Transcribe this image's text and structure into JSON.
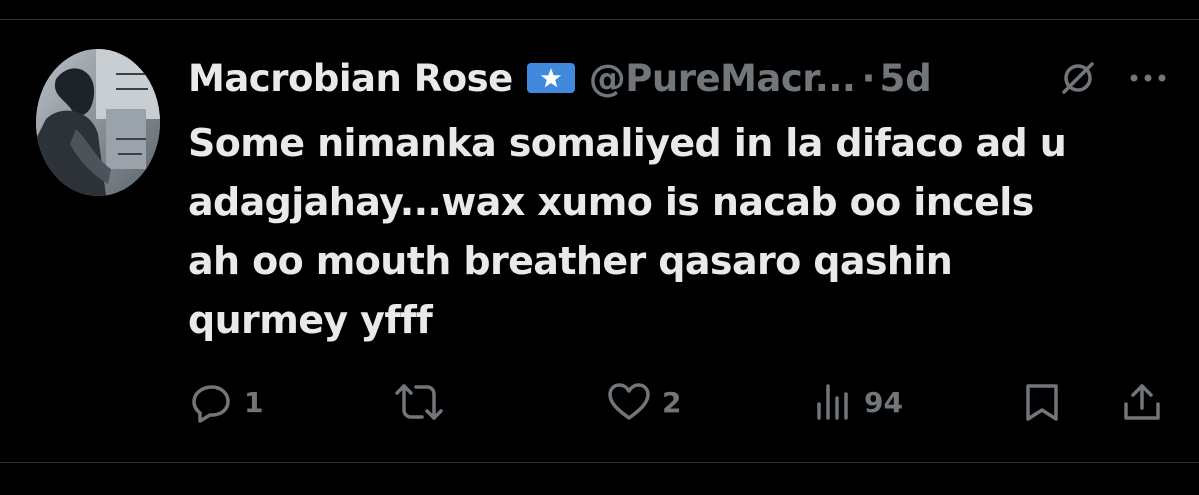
{
  "tweet": {
    "display_name": "Macrobian Rose",
    "flag_icon": "somalia-flag-icon",
    "handle": "@PureMacr...",
    "separator": "·",
    "time": "5d",
    "text": "Some nimanka somaliyed in la difaco ad u\nadagjahay...wax xumo is nacab oo incels\nah oo mouth breather qasaro qashin\nqurmey yfff",
    "avatar_icon": "profile-photo"
  },
  "actions": {
    "reply": {
      "icon": "reply-icon",
      "count": "1"
    },
    "retweet": {
      "icon": "retweet-icon",
      "count": ""
    },
    "like": {
      "icon": "heart-icon",
      "count": "2"
    },
    "views": {
      "icon": "views-icon",
      "count": "94"
    },
    "bookmark": {
      "icon": "bookmark-icon"
    },
    "share": {
      "icon": "share-icon"
    }
  },
  "colors": {
    "background": "#000000",
    "text_primary": "#e7e9ea",
    "text_secondary": "#71767b",
    "divider": "#2f3336",
    "flag_blue": "#4189dd"
  }
}
